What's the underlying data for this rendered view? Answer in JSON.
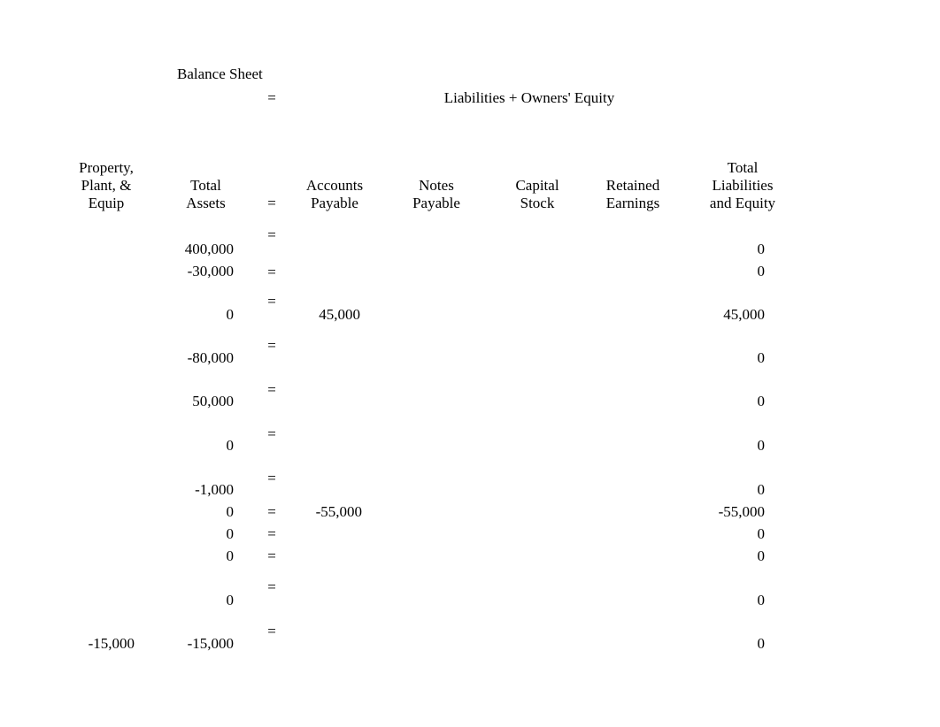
{
  "document": {
    "title_left": "Balance Sheet",
    "equals_top": "=",
    "title_right": "Liabilities + Owners' Equity"
  },
  "columns": [
    {
      "key": "ppe",
      "header_lines": [
        "Property,",
        "Plant, &",
        "Equip"
      ]
    },
    {
      "key": "total_assets",
      "header_lines": [
        "",
        "Total",
        "Assets"
      ]
    },
    {
      "key": "equals",
      "header_lines": [
        "",
        "",
        "="
      ]
    },
    {
      "key": "ap",
      "header_lines": [
        "",
        "Accounts",
        "Payable"
      ]
    },
    {
      "key": "np",
      "header_lines": [
        "",
        "Notes",
        "Payable"
      ]
    },
    {
      "key": "cs",
      "header_lines": [
        "",
        "Capital",
        "Stock"
      ]
    },
    {
      "key": "re",
      "header_lines": [
        "",
        "Retained",
        "Earnings"
      ]
    },
    {
      "key": "tle",
      "header_lines": [
        "Total",
        "Liabilities",
        "and Equity"
      ]
    }
  ],
  "equals_column": [
    "=",
    "=",
    "=",
    "=",
    "=",
    "=",
    "=",
    "=",
    "=",
    "=",
    "=",
    "="
  ],
  "rows": [
    {
      "ppe": "",
      "total_assets": "400,000",
      "ap": "",
      "np": "",
      "cs": "",
      "re": "",
      "tle": "0"
    },
    {
      "ppe": "",
      "total_assets": "-30,000",
      "ap": "",
      "np": "",
      "cs": "",
      "re": "",
      "tle": "0"
    },
    {
      "ppe": "",
      "total_assets": "0",
      "ap": "45,000",
      "np": "",
      "cs": "",
      "re": "",
      "tle": "45,000"
    },
    {
      "ppe": "",
      "total_assets": "-80,000",
      "ap": "",
      "np": "",
      "cs": "",
      "re": "",
      "tle": "0"
    },
    {
      "ppe": "",
      "total_assets": "50,000",
      "ap": "",
      "np": "",
      "cs": "",
      "re": "",
      "tle": "0"
    },
    {
      "ppe": "",
      "total_assets": "0",
      "ap": "",
      "np": "",
      "cs": "",
      "re": "",
      "tle": "0"
    },
    {
      "ppe": "",
      "total_assets": "-1,000",
      "ap": "",
      "np": "",
      "cs": "",
      "re": "",
      "tle": "0"
    },
    {
      "ppe": "",
      "total_assets": "0",
      "ap": "-55,000",
      "np": "",
      "cs": "",
      "re": "",
      "tle": "-55,000"
    },
    {
      "ppe": "",
      "total_assets": "0",
      "ap": "",
      "np": "",
      "cs": "",
      "re": "",
      "tle": "0"
    },
    {
      "ppe": "",
      "total_assets": "0",
      "ap": "",
      "np": "",
      "cs": "",
      "re": "",
      "tle": "0"
    },
    {
      "ppe": "",
      "total_assets": "0",
      "ap": "",
      "np": "",
      "cs": "",
      "re": "",
      "tle": "0"
    },
    {
      "ppe": "-15,000",
      "total_assets": "-15,000",
      "ap": "",
      "np": "",
      "cs": "",
      "re": "",
      "tle": "0"
    }
  ]
}
